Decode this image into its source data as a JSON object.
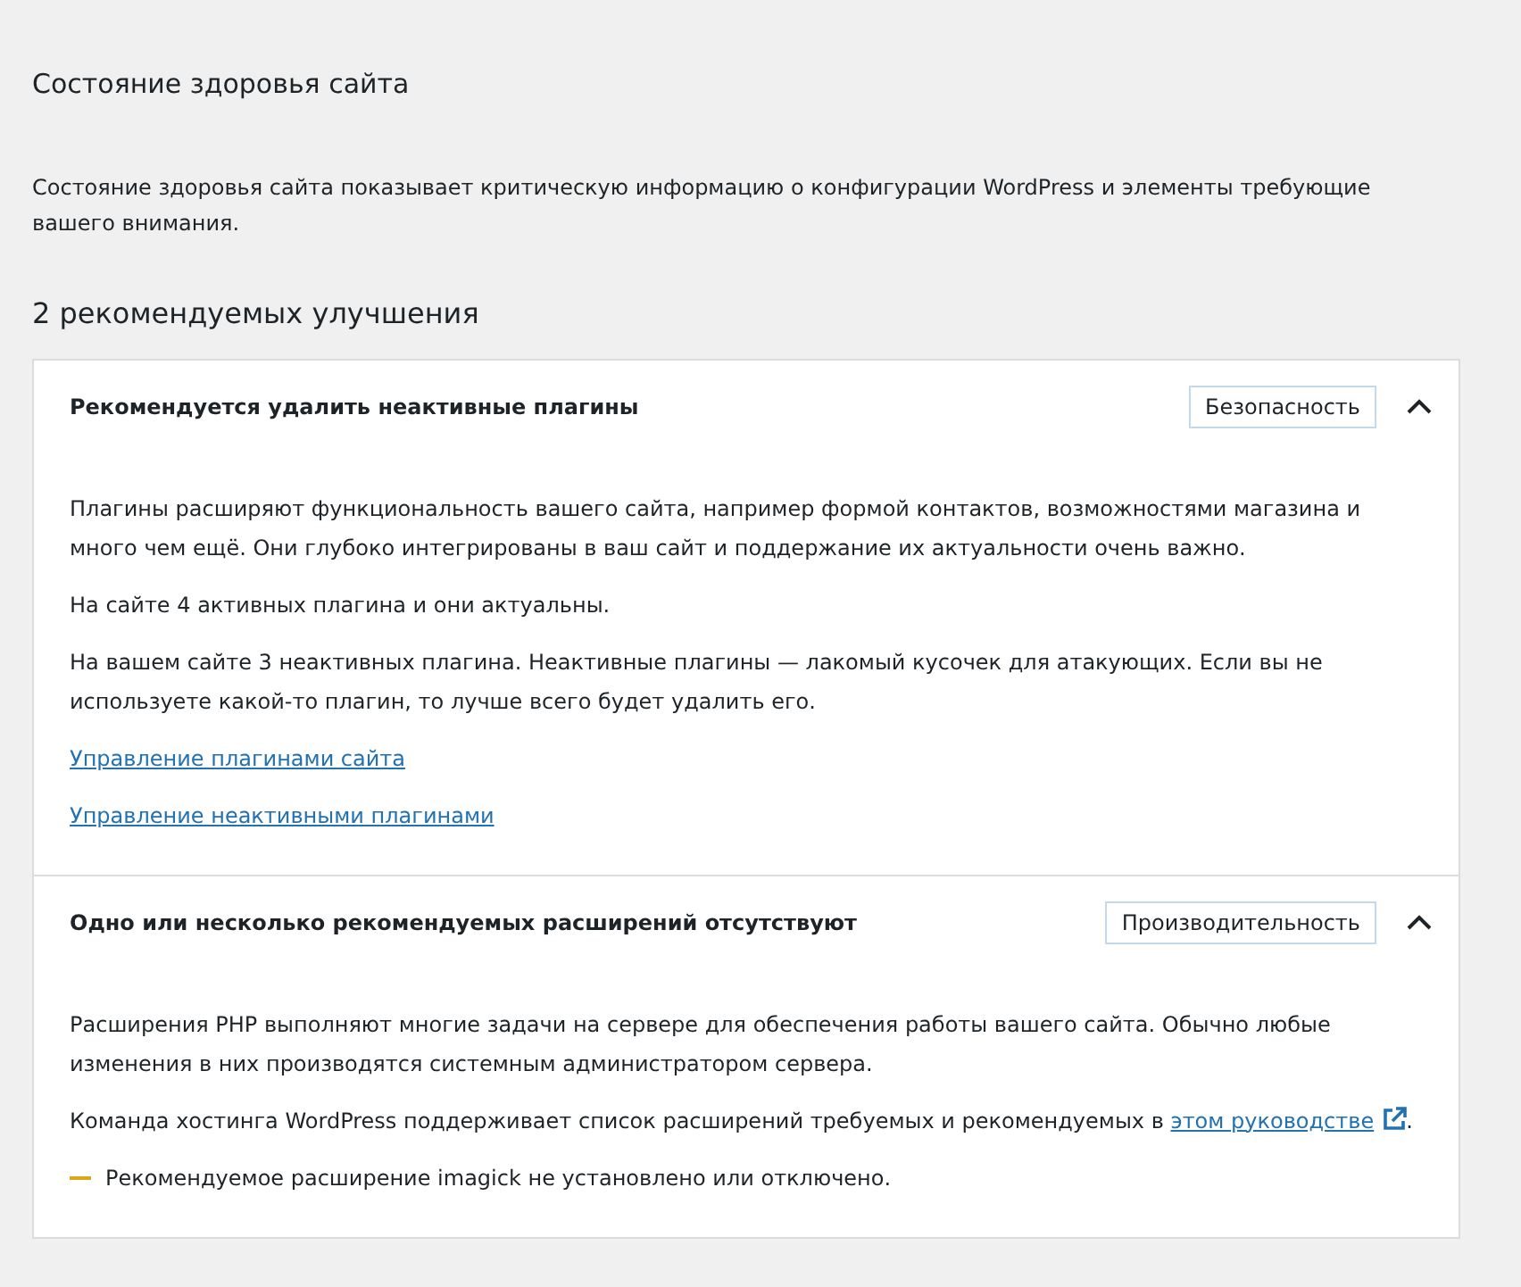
{
  "title": "Состояние здоровья сайта",
  "description": "Состояние здоровья сайта показывает критическую информацию о конфигурации WordPress и элементы требующие вашего внимания.",
  "section_heading": "2 рекомендуемых улучшения",
  "issues": [
    {
      "title": "Рекомендуется удалить неактивные плагины",
      "badge": "Безопасность",
      "expanded": true,
      "blocks": [
        {
          "kind": "paragraph",
          "text": "Плагины расширяют функциональность вашего сайта, например формой контактов, возможностями магазина и много чем ещё. Они глубоко интегрированы в ваш сайт и поддержание их актуальности очень важно."
        },
        {
          "kind": "paragraph",
          "text": "На сайте 4 активных плагина и они актуальны."
        },
        {
          "kind": "paragraph",
          "text": "На вашем сайте 3 неактивных плагина. Неактивные плагины — лакомый кусочек для атакующих. Если вы не используете какой-то плагин, то лучше всего будет удалить его."
        },
        {
          "kind": "link",
          "text": "Управление плагинами сайта"
        },
        {
          "kind": "link",
          "text": "Управление неактивными плагинами"
        }
      ]
    },
    {
      "title": "Одно или несколько рекомендуемых расширений отсутствуют",
      "badge": "Производительность",
      "expanded": true,
      "blocks": [
        {
          "kind": "paragraph",
          "text": "Расширения PHP выполняют многие задачи на сервере для обеспечения работы вашего сайта. Обычно любые изменения в них производятся системным администратором сервера."
        },
        {
          "kind": "paragraph_link",
          "text": "Команда хостинга WordPress поддерживает список расширений требуемых и рекомендуемых в ",
          "link": "этом руководстве",
          "tail": "."
        },
        {
          "kind": "warning",
          "text": "Рекомендуемое расширение imagick не установлено или отключено."
        }
      ]
    }
  ]
}
